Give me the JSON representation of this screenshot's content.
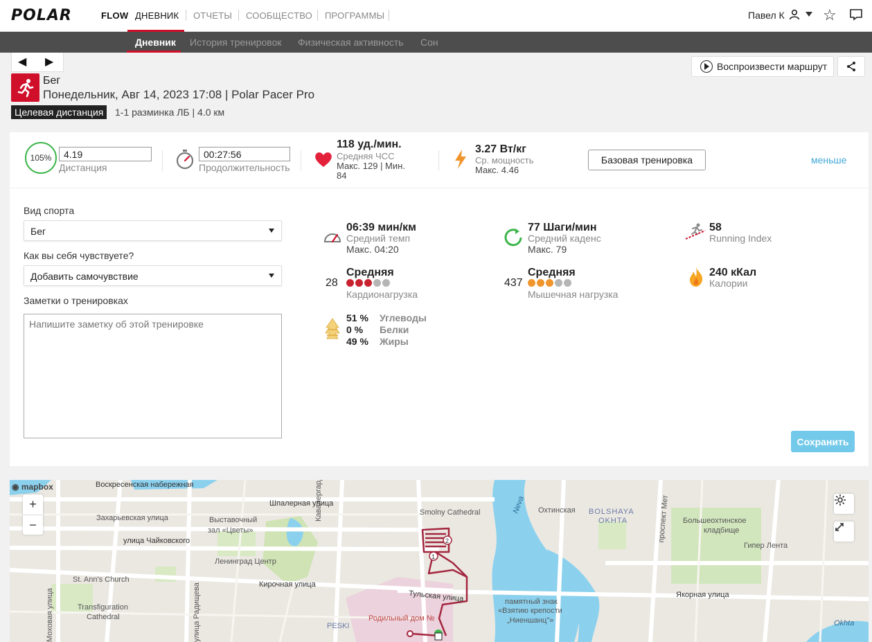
{
  "brand": {
    "logo": "POLAR",
    "product": "FLOW"
  },
  "nav": {
    "items": [
      {
        "label": "ДНЕВНИК",
        "active": true
      },
      {
        "label": "ОТЧЕТЫ",
        "active": false
      },
      {
        "label": "СООБЩЕСТВО",
        "active": false
      },
      {
        "label": "ПРОГРАММЫ",
        "active": false
      }
    ],
    "user_name": "Павел К",
    "icons": [
      "user-icon",
      "caret-icon",
      "star-icon",
      "message-icon"
    ]
  },
  "subnav": {
    "items": [
      {
        "label": "Дневник",
        "active": true
      },
      {
        "label": "История тренировок",
        "active": false
      },
      {
        "label": "Физическая активность",
        "active": false
      },
      {
        "label": "Сон",
        "active": false
      }
    ]
  },
  "header": {
    "prev": "◀",
    "next": "▶",
    "sport": "Бег",
    "subtitle": "Понедельник, Авг 14, 2023 17:08 | Polar Pacer Pro",
    "target_badge": "Целевая дистанция",
    "target_text": "1-1 разминка ЛБ  | 4.0 км",
    "replay_button": "Воспроизвести маршрут"
  },
  "summary": {
    "target_percent": "105%",
    "distance_value": "4.19",
    "distance_label": "Дистанция",
    "duration_value": "00:27:56",
    "duration_label": "Продолжительность",
    "hr_value": "118 уд./мин.",
    "hr_label": "Средняя ЧСС",
    "hr_max": "Макс. 129  |  Мин.",
    "hr_min": "84",
    "power_value": "3.27 Вт/кг",
    "power_label": "Ср. мощность",
    "power_max": "Макс. 4.46",
    "base_training_button": "Базовая тренировка",
    "less_link": "меньше"
  },
  "form": {
    "sport_label": "Вид спорта",
    "sport_value": "Бег",
    "feeling_label": "Как вы себя чувствуете?",
    "feeling_value": "Добавить самочувствие",
    "notes_label": "Заметки о тренировках",
    "notes_placeholder": "Напишите заметку об этой тренировке",
    "save_button": "Сохранить"
  },
  "metrics": {
    "pace_value": "06:39 мин/км",
    "pace_label": "Средний темп",
    "pace_max": "Макс. 04:20",
    "cadence_value": "77 Шаги/мин",
    "cadence_label": "Средний каденс",
    "cadence_max": "Макс. 79",
    "running_index_value": "58",
    "running_index_label": "Running Index",
    "cardio_number": "28",
    "cardio_level": "Средняя",
    "cardio_label": "Кардионагрузка",
    "cardio_dots_filled": 3,
    "cardio_dots_total": 5,
    "muscle_number": "437",
    "muscle_level": "Средняя",
    "muscle_label": "Мышечная нагрузка",
    "muscle_dots_filled": 3,
    "muscle_dots_total": 5,
    "calories_value": "240 кКал",
    "calories_label": "Калории",
    "carbs_pct": "51 %",
    "carbs_label": "Углеводы",
    "protein_pct": "0 %",
    "protein_label": "Белки",
    "fat_pct": "49 %",
    "fat_label": "Жиры"
  },
  "map": {
    "attribution": "mapbox",
    "zoom_in": "+",
    "zoom_out": "−",
    "labels": [
      "Воскресенская набережная",
      "Шпалерная улица",
      "Захарьевская улица",
      "Выставочный",
      "зал «Цветы»",
      "улица Чайковского",
      "Ленинград Центр",
      "St. Ann's Church",
      "Кирочная улица",
      "Transfiguration",
      "Cathedral",
      "Кавалергардская улица",
      "Smolny Cathedral",
      "Тульская улица",
      "Родильный дом №",
      "PESKI",
      "Neva",
      "Охтинская",
      "BOLSHAYA",
      "OKHTA",
      "проспект Мет",
      "Большеохтинское",
      "кладбище",
      "Гипер Лента",
      "памятный знак",
      "«Взятию крепости",
      "„Ниеншанц\"»",
      "Якорная улица",
      "Okhta",
      "улица Радищева",
      "Захарьевская улица",
      "Моховая улица"
    ],
    "route_markers": [
      "1",
      "2"
    ]
  },
  "colors": {
    "brand_red": "#d0102a",
    "accent_blue": "#43a8d7",
    "cardio_dot": "#c9222f",
    "muscle_dot": "#f0952c",
    "dot_empty": "#b5b5b5",
    "route": "#a3263f"
  }
}
